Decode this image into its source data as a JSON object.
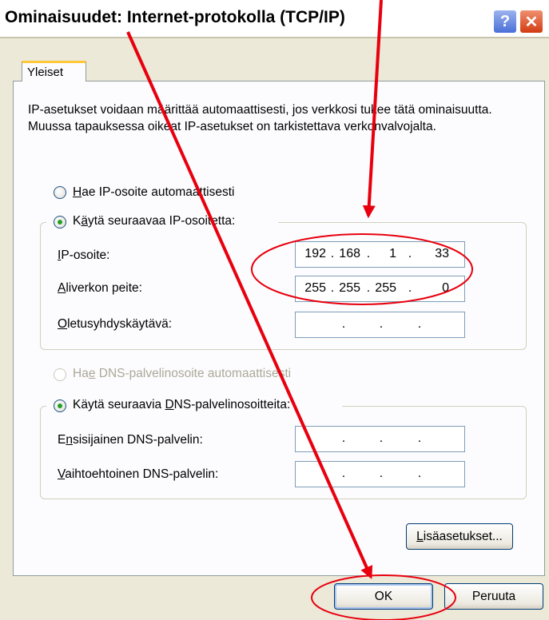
{
  "window": {
    "title": "Ominaisuudet: Internet-protokolla (TCP/IP)",
    "help_label": "?",
    "close_label": "✕"
  },
  "tab": {
    "label": "Yleiset"
  },
  "description": "IP-asetukset voidaan määrittää automaattisesti, jos verkkosi tukee tätä ominaisuutta. Muussa tapauksessa oikeat IP-asetukset on tarkistettava verkonvalvojalta.",
  "ip_section": {
    "auto_label_key": "H",
    "auto_label_rest": "ae IP-osoite automaattisesti",
    "auto_checked": false,
    "manual_label_pre": "K",
    "manual_label_key": "ä",
    "manual_label_rest": "ytä seuraavaa IP-osoitetta:",
    "manual_checked": true,
    "fields": [
      {
        "key": "I",
        "rest": "P-osoite:",
        "octets": [
          "192",
          "168",
          "1",
          "33"
        ]
      },
      {
        "key": "A",
        "rest": "liverkon peite:",
        "octets": [
          "255",
          "255",
          "255",
          "0"
        ]
      },
      {
        "key": "O",
        "rest": "letusyhdyskäytävä:",
        "octets": [
          "",
          "",
          "",
          ""
        ]
      }
    ]
  },
  "dns_section": {
    "auto_label_pre": "Ha",
    "auto_label_key": "e",
    "auto_label_rest": " DNS-palvelinosoite automaattisesti",
    "auto_disabled": true,
    "manual_label_pre": "Käytä seuraavia ",
    "manual_label_key": "D",
    "manual_label_rest": "NS-palvelinosoitteita:",
    "manual_checked": true,
    "fields": [
      {
        "pre": "E",
        "key": "n",
        "rest": "sisijainen DNS-palvelin:",
        "octets": [
          "",
          "",
          "",
          ""
        ]
      },
      {
        "pre": "",
        "key": "V",
        "rest": "aihtoehtoinen DNS-palvelin:",
        "octets": [
          "",
          "",
          "",
          ""
        ]
      }
    ]
  },
  "buttons": {
    "advanced_key": "L",
    "advanced_rest": "isäasetukset...",
    "ok": "OK",
    "cancel": "Peruuta"
  },
  "annotation_color": "#e8000e"
}
